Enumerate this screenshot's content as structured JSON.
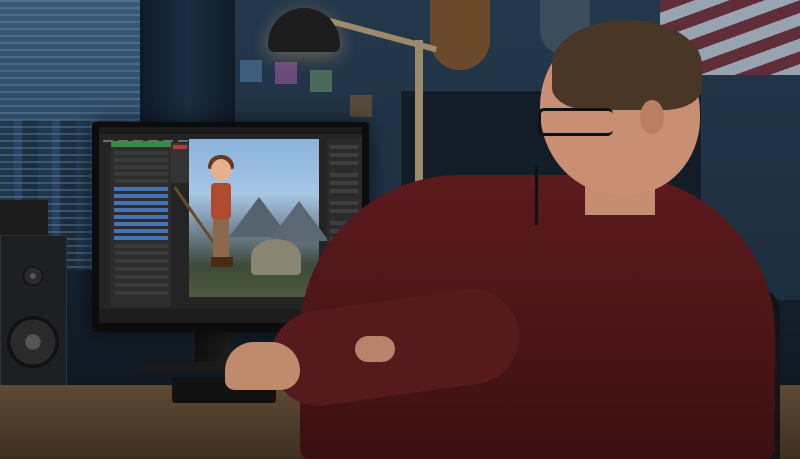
{
  "scene": {
    "description_colors": {
      "hoodie": "#5c1a1d",
      "wall": "#1c2d3e",
      "desk": "#5e4a34",
      "blender_accent_green": "#3a8a47",
      "blender_selection_blue": "#4772b3",
      "lamp_glow": "#ffc878"
    },
    "icons": [
      "desk-lamp-icon",
      "speaker-icon",
      "monitor-icon",
      "keyboard-icon"
    ]
  }
}
